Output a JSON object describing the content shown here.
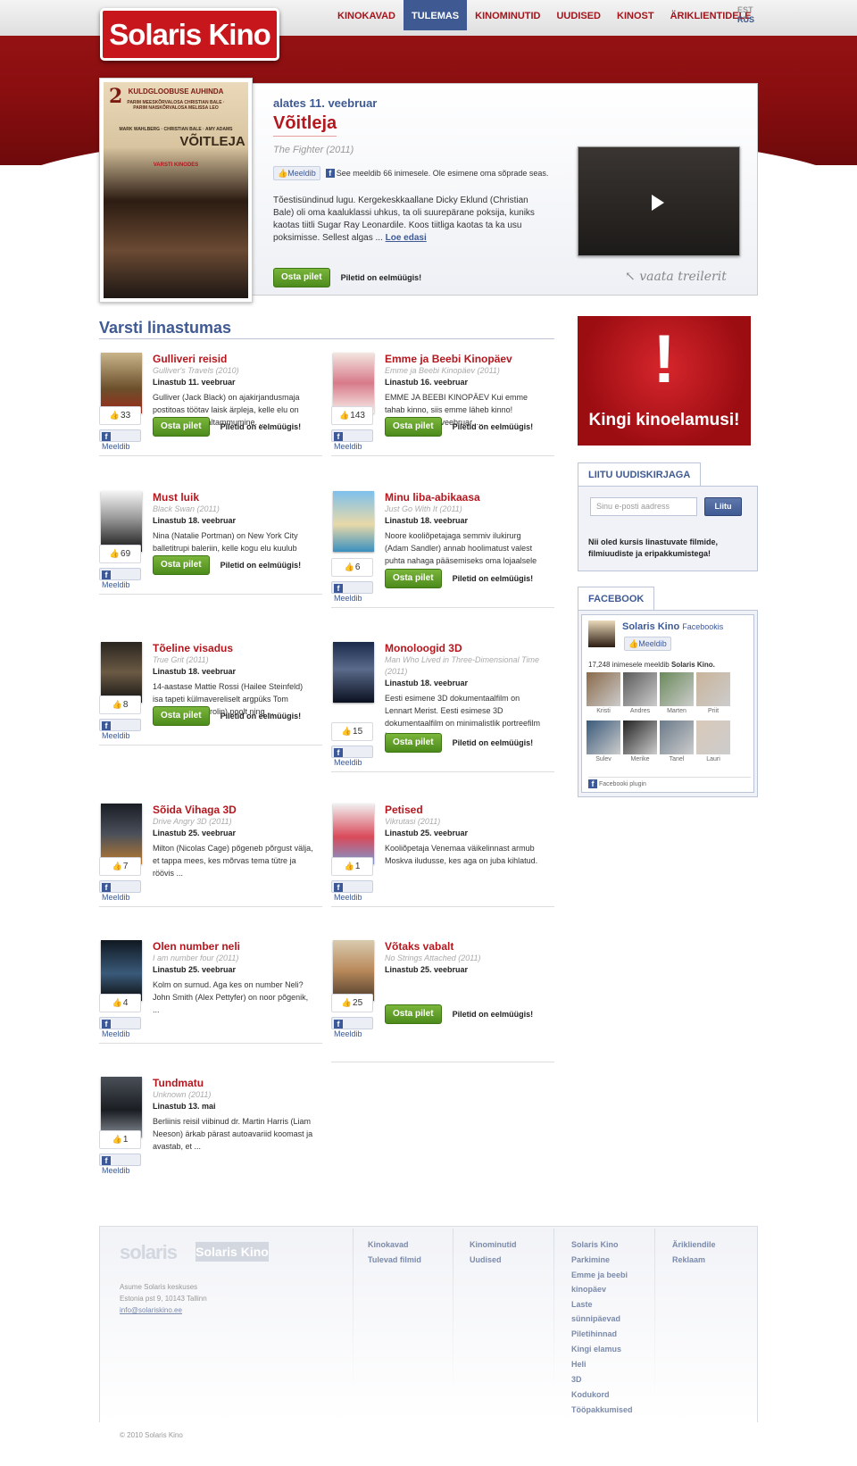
{
  "brand": {
    "logo_text": "Solaris Kino"
  },
  "nav": {
    "items": [
      "Kinokavad",
      "Tulemas",
      "Kinominutid",
      "Uudised",
      "Kinost",
      "Äriklientidele"
    ],
    "active": "Tulemas"
  },
  "lang": {
    "est": "EST",
    "rus": "RUS"
  },
  "featured": {
    "date": "alates 11. veebruar",
    "title": "Võitleja",
    "original": "The Fighter (2011)",
    "like_label": "Meeldib",
    "fb_text": "See meeldib 66 inimesele. Ole esimene oma sõprade seas.",
    "description": "Tõestisündinud lugu. Kergekeskkaallane Dicky Eklund (Christian Bale) oli oma kaaluklassi uhkus, ta oli suurepärane poksija, kuniks kaotas tiitli Sugar Ray Leonardile. Koos tiitliga kaotas ta ka usu poksimisse. Sellest algas ...",
    "read_more": "Loe edasi",
    "buy_label": "Osta pilet",
    "presale": "Piletid on eelmüügis!",
    "trailer_note": "vaata treilerit",
    "poster": {
      "award_line": "KULDGLOOBUSE AUHINDA",
      "nominees": "PARIM MEESKÕRVALOSA CHRISTIAN BALE · PARIM NAISKÕRVALOSA MELISSA LEO",
      "cast": "MARK WAHLBERG · CHRISTIAN BALE · AMY ADAMS",
      "title": "VÕITLEJA",
      "footer": "VARSTI KINODES",
      "award_count": "2"
    }
  },
  "section_title": "Varsti linastumas",
  "movies": [
    {
      "title": "Gulliveri reisid",
      "original": "Gulliver's Travels (2010)",
      "date": "Linastub 11. veebruar",
      "summary": "Gulliver (Jack Black) on ajakirjandusmaja postitoas töötav laisk ärpleja, kelle elu on üks lõputu paigaltammumine. ...",
      "likes": "33",
      "has_buy": true
    },
    {
      "title": "Emme ja Beebi Kinopäev",
      "original": "Emme ja Beebi Kinopäev (2011)",
      "date": "Linastub 16. veebruar",
      "summary": "EMME JA BEEBI KINOPÄEV Kui emme tahab kinno, siis emme läheb kinno! Kolmapäev 16. veebruar, ...",
      "likes": "143",
      "has_buy": true
    },
    {
      "title": "Must luik",
      "original": "Black Swan (2011)",
      "date": "Linastub 18. veebruar",
      "summary": "Nina (Natalie Portman) on New York City balletitrupi baleriin, kelle kogu elu kuulub tantsule. Ta ...",
      "likes": "69",
      "has_buy": true
    },
    {
      "title": "Minu liba-abikaasa",
      "original": "Just Go With It (2011)",
      "date": "Linastub 18. veebruar",
      "summary": "Noore kooliõpetajaga semmiv ilukirurg (Adam Sandler) annab hoolimatust valest puhta nahaga pääsemiseks oma lojaalsele assistendile ...",
      "likes": "6",
      "has_buy": true
    },
    {
      "title": "Tõeline visadus",
      "original": "True Grit (2011)",
      "date": "Linastub 18. veebruar",
      "summary": "14-aastase Mattie Rossi (Hailee Steinfeld) isa tapeti külmavereliselt argpüks Tom Chaney (Josh Brolin) poolt ning ...",
      "likes": "8",
      "has_buy": true
    },
    {
      "title": "Monoloogid 3D",
      "original": "Man Who Lived in Three-Dimensional Time (2011)",
      "date": "Linastub 18. veebruar",
      "summary": "Eesti esimene 3D dokumentaalfilm on Lennart Merist. Eesti esimese 3D dokumentaalfilm on minimalistlik portreefilm Lennart ...",
      "likes": "15",
      "has_buy": true
    },
    {
      "title": "Sõida Vihaga 3D",
      "original": "Drive Angry 3D (2011)",
      "date": "Linastub 25. veebruar",
      "summary": "Milton (Nicolas Cage) põgeneb põrgust välja, et tappa mees, kes mõrvas tema tütre ja röövis ...",
      "likes": "7",
      "has_buy": false
    },
    {
      "title": "Petised",
      "original": "Vikrutasi (2011)",
      "date": "Linastub 25. veebruar",
      "summary": "Kooliõpetaja Venemaa väikelinnast armub Moskva iludusse, kes aga on juba kihlatud.",
      "likes": "1",
      "has_buy": false
    },
    {
      "title": "Olen number neli",
      "original": "I am number four (2011)",
      "date": "Linastub 25. veebruar",
      "summary": "Kolm on surnud. Aga kes on number Neli? John Smith (Alex Pettyfer) on noor põgenik, ...",
      "likes": "4",
      "has_buy": false
    },
    {
      "title": "Võtaks vabalt",
      "original": "No Strings Attached (2011)",
      "date": "Linastub 25. veebruar",
      "summary": "",
      "likes": "25",
      "has_buy": true
    },
    {
      "title": "Tundmatu",
      "original": "Unknown (2011)",
      "date": "Linastub 13. mai",
      "summary": "Berliinis reisil viibinud dr. Martin Harris (Liam Neeson) ärkab pärast autoavariid koomast ja avastab, et ...",
      "likes": "1",
      "has_buy": false
    }
  ],
  "movie_labels": {
    "like": "Meeldib",
    "buy": "Osta pilet",
    "presale": "Piletid on eelmüügis!"
  },
  "promo": {
    "mark": "!",
    "text": "Kingi kinoelamusi!"
  },
  "newsletter": {
    "tab": "LIITU UUDISKIRJAGA",
    "placeholder": "Sinu e-posti aadress",
    "button": "Liitu",
    "text": "Nii oled kursis linastuvate filmide, filmiuudiste ja eripakkumistega!"
  },
  "facebook": {
    "tab": "FACEBOOK",
    "page_name": "Solaris Kino",
    "page_suffix": "Facebookis",
    "like": "Meeldib",
    "count_text": "17,248 inimesele meeldib",
    "count_bold": "Solaris Kino.",
    "fans": [
      "Kristi",
      "Andres",
      "Marten",
      "Priit",
      "Sulev",
      "Merike",
      "Tanel",
      "Lauri"
    ],
    "plugin": "Facebooki plugin"
  },
  "footer": {
    "logos": [
      "solaris",
      "Solaris Kino"
    ],
    "address": [
      "Asume Solaris keskuses",
      "Estonia pst 9, 10143 Tallinn"
    ],
    "email": "info@solariskino.ee",
    "copyright": "© 2010 Solaris Kino",
    "col1": [
      "Kinokavad",
      "Tulevad filmid"
    ],
    "col2": [
      "Kinominutid",
      "Uudised"
    ],
    "col3": [
      "Solaris Kino",
      "Parkimine",
      "Emme ja beebi kinopäev",
      "Laste sünnipäevad",
      "Piletihinnad",
      "Kingi elamus",
      "Heli",
      "3D",
      "Kodukord",
      "Tööpakkumised"
    ],
    "col4": [
      "Ärikliendile",
      "Reklaam"
    ]
  }
}
